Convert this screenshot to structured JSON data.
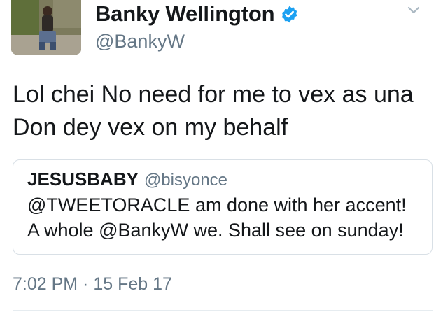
{
  "author": {
    "display_name": "Banky Wellington",
    "handle": "@BankyW",
    "verified": true,
    "avatar_icon": "profile-photo",
    "verified_icon": "verified-badge-icon",
    "menu_icon": "chevron-down-icon"
  },
  "tweet": {
    "text": "Lol chei No need for me to vex as una\nDon dey vex on my behalf",
    "timestamp": "7:02 PM · 15 Feb 17"
  },
  "quoted_tweet": {
    "display_name": "JESUSBABY",
    "handle": "@bisyonce",
    "text": "@TWEETORACLE am done with her accent!\nA whole @BankyW we. Shall see on sunday!"
  },
  "colors": {
    "verified": "#1da1f2",
    "secondary_text": "#657786",
    "primary_text": "#14171a",
    "border": "#d9e0e6"
  }
}
